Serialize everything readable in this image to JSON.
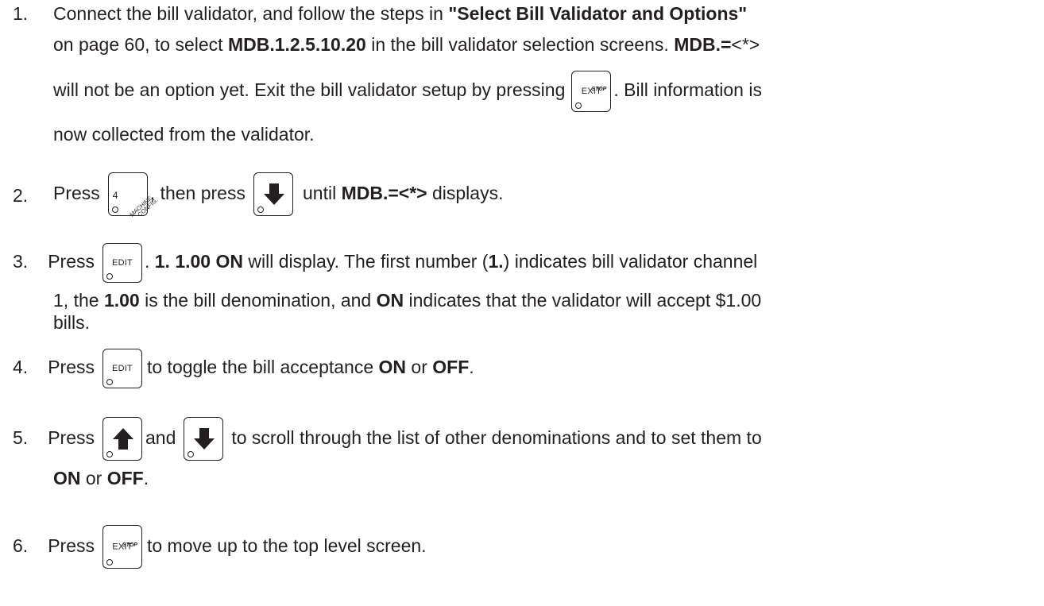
{
  "steps": [
    {
      "number": "1.",
      "line1": {
        "t1": "Connect the bill validator, and follow the steps in ",
        "b1": "\"Select Bill Validator and Options\""
      },
      "line2": {
        "t1": "on page 60, to select ",
        "b1": "MDB.1.2.5.10.20",
        "t2": " in the bill validator selection screens. ",
        "b2": "MDB.=",
        "t3": "<*>"
      },
      "line3": {
        "t1": "will not be an option yet. Exit the bill validator setup by pressing",
        "t2": ". Bill information is"
      },
      "line4": {
        "t1": "now collected from the validator."
      }
    },
    {
      "number": "2.",
      "t1": "Press",
      "t2": ", then press",
      "t3": "until ",
      "b1": "MDB.=<*>",
      "t4": " displays."
    },
    {
      "number": "3.",
      "line1": {
        "t1": "Press",
        "t2": ". ",
        "b1": "1. 1.00 ON",
        "t3": " will display. The first number (",
        "b2": "1.",
        "t4": ") indicates bill validator channel"
      },
      "line2": {
        "t1": "1, the ",
        "b1": "1.00",
        "t2": " is the bill denomination, and ",
        "b2": "ON",
        "t3": " indicates that the validator will accept $1.00"
      },
      "line3": {
        "t1": "bills."
      }
    },
    {
      "number": "4.",
      "t1": "Press",
      "t2": "to toggle the bill acceptance ",
      "b1": "ON",
      "t3": " or ",
      "b2": "OFF",
      "t4": "."
    },
    {
      "number": "5.",
      "line1": {
        "t1": "Press",
        "t2": "and",
        "t3": "to scroll through the list of other denominations and to set them to"
      },
      "line2": {
        "b1": "ON",
        "t1": " or ",
        "b2": "OFF",
        "t2": "."
      }
    },
    {
      "number": "6.",
      "t1": "Press",
      "t2": "to move up to the top level screen."
    }
  ],
  "keys": {
    "exit": {
      "label": "EXIT",
      "sublabel": "STOP",
      "icon": "exit-key-icon"
    },
    "edit": {
      "label": "EDIT",
      "icon": "edit-key-icon"
    },
    "machine_config": {
      "number": "4",
      "line1": "MACHINE",
      "line2": "CONFIG.",
      "icon": "machine-config-key-icon"
    },
    "down_arrow": {
      "icon": "down-arrow-key-icon"
    },
    "up_arrow": {
      "icon": "up-arrow-key-icon"
    }
  }
}
